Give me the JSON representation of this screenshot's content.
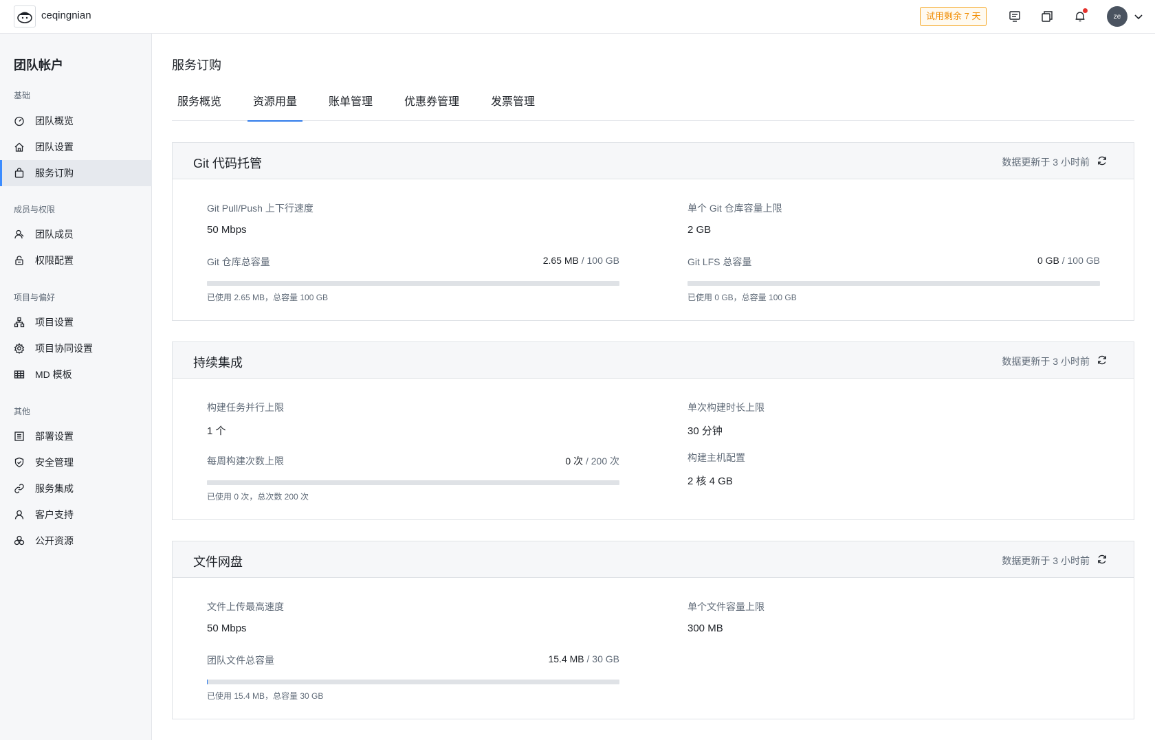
{
  "header": {
    "team_name": "ceqingnian",
    "trial_badge": "试用剩余 7 天",
    "avatar_initials": "ze",
    "icons": [
      "doc-icon",
      "copy-icon",
      "bell-icon",
      "chevron-down-icon"
    ],
    "notification_dot_color": "#e5322d"
  },
  "sidebar": {
    "title": "团队帐户",
    "groups": [
      {
        "label": "基础",
        "items": [
          {
            "label": "团队概览",
            "icon": "dashboard-icon"
          },
          {
            "label": "团队设置",
            "icon": "home-icon"
          },
          {
            "label": "服务订购",
            "icon": "bag-icon",
            "active": true
          }
        ]
      },
      {
        "label": "成员与权限",
        "items": [
          {
            "label": "团队成员",
            "icon": "users-icon"
          },
          {
            "label": "权限配置",
            "icon": "lock-icon"
          }
        ]
      },
      {
        "label": "项目与偏好",
        "items": [
          {
            "label": "项目设置",
            "icon": "hierarchy-icon"
          },
          {
            "label": "项目协同设置",
            "icon": "gear-icon"
          },
          {
            "label": "MD 模板",
            "icon": "table-icon"
          }
        ]
      },
      {
        "label": "其他",
        "items": [
          {
            "label": "部署设置",
            "icon": "list-icon"
          },
          {
            "label": "安全管理",
            "icon": "shield-icon"
          },
          {
            "label": "服务集成",
            "icon": "link-icon"
          },
          {
            "label": "客户支持",
            "icon": "user-icon"
          },
          {
            "label": "公开资源",
            "icon": "cubes-icon"
          }
        ]
      }
    ]
  },
  "main": {
    "page_title": "服务订购",
    "tabs": [
      {
        "label": "服务概览"
      },
      {
        "label": "资源用量",
        "active": true
      },
      {
        "label": "账单管理"
      },
      {
        "label": "优惠券管理"
      },
      {
        "label": "发票管理"
      }
    ],
    "accent_color": "#2f7bea",
    "cards": [
      {
        "title": "Git 代码托管",
        "updated": "数据更新于 3 小时前",
        "metrics": [
          {
            "label": "Git Pull/Push 上下行速度",
            "value": "50 Mbps"
          },
          {
            "label": "单个 Git 仓库容量上限",
            "value": "2 GB"
          }
        ],
        "usages": [
          {
            "label": "Git 仓库总容量",
            "used": "2.65 MB",
            "separator": "/",
            "total": "100 GB",
            "note": "已使用 2.65 MB，总容量 100 GB",
            "fraction": 2.65e-05
          },
          {
            "label": "Git LFS 总容量",
            "used": "0 GB",
            "separator": "/",
            "total": "100 GB",
            "note": "已使用 0 GB，总容量 100 GB",
            "fraction": 0
          }
        ]
      },
      {
        "title": "持续集成",
        "updated": "数据更新于 3 小时前",
        "metrics": [
          {
            "label": "构建任务并行上限",
            "value": "1 个"
          },
          {
            "label": "单次构建时长上限",
            "value": "30 分钟"
          },
          {
            "label": "构建主机配置",
            "value": "2 核 4 GB"
          }
        ],
        "usages": [
          {
            "label": "每周构建次数上限",
            "used": "0 次",
            "separator": "/",
            "total": "200 次",
            "note": "已使用 0 次，总次数 200 次",
            "fraction": 0
          }
        ]
      },
      {
        "title": "文件网盘",
        "updated": "数据更新于 3 小时前",
        "metrics": [
          {
            "label": "文件上传最高速度",
            "value": "50 Mbps"
          },
          {
            "label": "单个文件容量上限",
            "value": "300 MB"
          }
        ],
        "usages": [
          {
            "label": "团队文件总容量",
            "used": "15.4 MB",
            "separator": "/",
            "total": "30 GB",
            "note": "已使用 15.4 MB，总容量 30 GB",
            "fraction": 0.0005
          }
        ]
      }
    ]
  }
}
